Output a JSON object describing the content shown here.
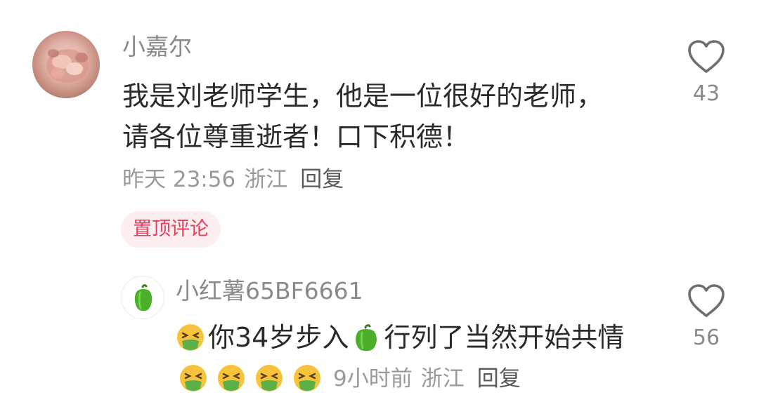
{
  "main_comment": {
    "username": "小嘉尔",
    "text": "我是刘老师学生，他是一位很好的老师，请各位尊重逝者！口下积德！",
    "time": "昨天 23:56",
    "location": "浙江",
    "reply_label": "回复",
    "pinned_label": "置顶评论",
    "like_count": "43"
  },
  "reply_comment": {
    "username": "小红薯65BF6661",
    "text_part1": "你34岁步入",
    "text_part2": "行列了当然开始共情",
    "time": "9小时前",
    "location": "浙江",
    "reply_label": "回复",
    "like_count": "56",
    "emojis": [
      "sick-face-emoji",
      "green-pepper-emoji",
      "sick-face-emoji",
      "sick-face-emoji",
      "sick-face-emoji",
      "sick-face-emoji"
    ]
  },
  "colors": {
    "pinned_text": "#e5405e",
    "pinned_bg": "#fdeef0",
    "meta_text": "#9a9a9a",
    "body_text": "#2a2a2a"
  }
}
